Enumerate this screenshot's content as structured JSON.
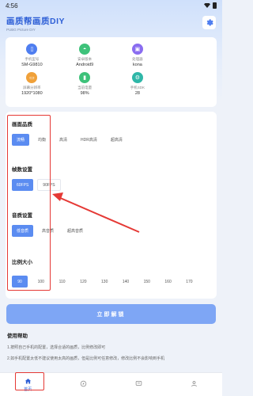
{
  "status": {
    "time": "4:56"
  },
  "app": {
    "title": "画质帮画质DIY",
    "subtitle": "PUBG Picture DIY"
  },
  "device_info": [
    {
      "label": "手机型号",
      "value": "SM-G9810",
      "icon": "phone-icon",
      "color": "#4f7ef0"
    },
    {
      "label": "安卓版本",
      "value": "Android9",
      "icon": "android-icon",
      "color": "#3ec27a"
    },
    {
      "label": "处理器",
      "value": "kona",
      "icon": "cpu-icon",
      "color": "#8a6df0"
    },
    {
      "label": "屏幕分辨率",
      "value": "1920*1080",
      "icon": "screen-icon",
      "color": "#f0a13a"
    },
    {
      "label": "当前电量",
      "value": "98%",
      "icon": "battery-icon",
      "color": "#3ec27a"
    },
    {
      "label": "手机SDK",
      "value": "28",
      "icon": "sdk-icon",
      "color": "#2fb7a8"
    }
  ],
  "quality": {
    "title": "画面品质",
    "options": [
      "流畅",
      "均衡",
      "高清",
      "HDR高清",
      "超高清"
    ],
    "selected_index": 0
  },
  "framerate": {
    "title": "帧数设置",
    "options": [
      "60FPS",
      "90FPS"
    ],
    "selected_index": 0
  },
  "sound": {
    "title": "音质设置",
    "options": [
      "低音质",
      "高音质",
      "超高音质"
    ],
    "selected_index": 0
  },
  "ratio": {
    "title": "比例大小",
    "options": [
      "90",
      "100",
      "110",
      "120",
      "130",
      "140",
      "150",
      "160",
      "170"
    ],
    "selected_index": 0
  },
  "apply_button": "立即解锁",
  "help": {
    "title": "使用帮助",
    "lines": [
      "1.按照自己手机的配置，选择合适的画质，比例修改即可",
      "2.如手机配置太低不建议使用太高的画质，但是比例可任意修改，修改比例不会影响到手机"
    ]
  },
  "nav": [
    {
      "label": "首页",
      "icon": "home-icon",
      "active": true
    },
    {
      "label": "",
      "icon": "compass-icon",
      "active": false
    },
    {
      "label": "",
      "icon": "message-icon",
      "active": false
    },
    {
      "label": "",
      "icon": "user-icon",
      "active": false
    }
  ],
  "colors": {
    "accent": "#5b8cf1",
    "annotation": "#e53935",
    "title": "#2e5fd6"
  }
}
